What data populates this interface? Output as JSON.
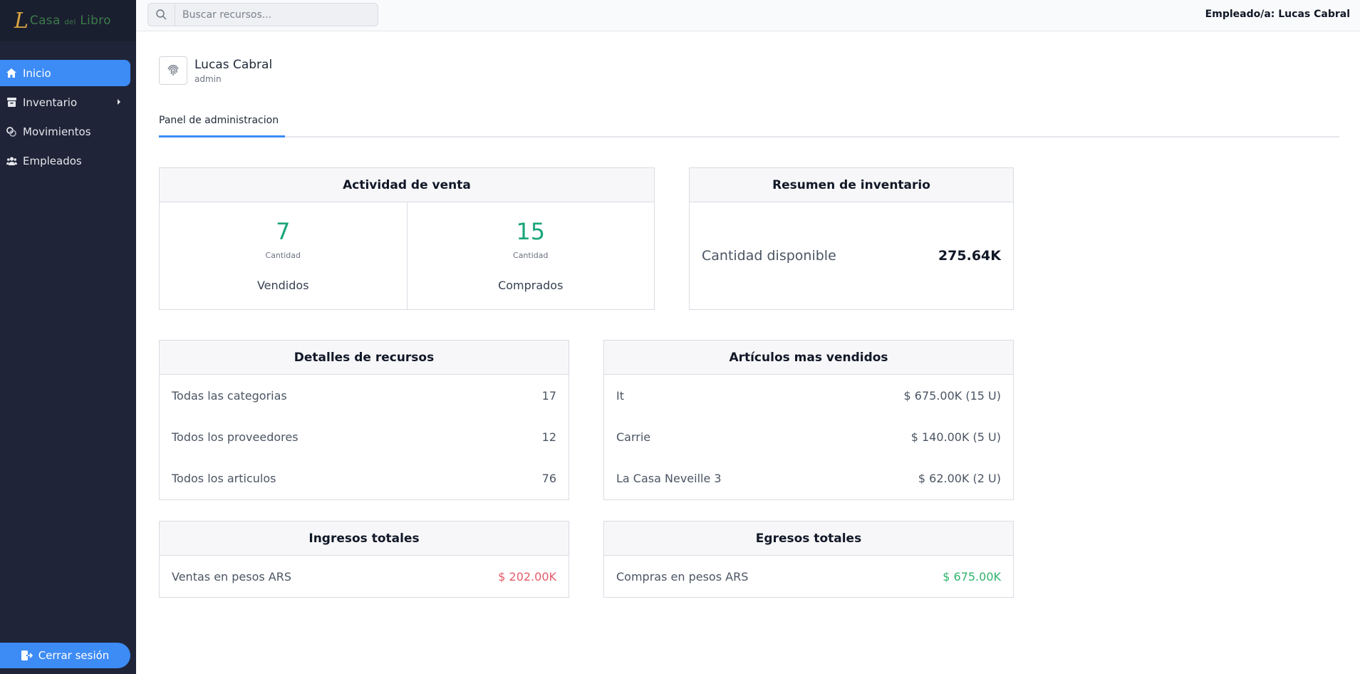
{
  "logo": {
    "mark": "L",
    "text_main": "Casa",
    "text_small": "del",
    "text_end": "Libro"
  },
  "sidebar": {
    "items": [
      {
        "label": "Inicio",
        "icon": "home-icon",
        "active": true
      },
      {
        "label": "Inventario",
        "icon": "archive-icon",
        "has_submenu": true
      },
      {
        "label": "Movimientos",
        "icon": "exchange-icon"
      },
      {
        "label": "Empleados",
        "icon": "users-icon"
      }
    ],
    "logout_label": "Cerrar sesión"
  },
  "topbar": {
    "search_placeholder": "Buscar recursos...",
    "user_label": "Empleado/a: Lucas Cabral"
  },
  "profile": {
    "name": "Lucas Cabral",
    "role": "admin"
  },
  "tabs": [
    {
      "label": "Panel de administracion",
      "active": true
    }
  ],
  "sales_activity": {
    "title": "Actividad de venta",
    "sold": {
      "value": "7",
      "sub": "Cantidad",
      "label": "Vendidos"
    },
    "bought": {
      "value": "15",
      "sub": "Cantidad",
      "label": "Comprados"
    }
  },
  "inventory_summary": {
    "title": "Resumen de inventario",
    "label": "Cantidad disponible",
    "value": "275.64K"
  },
  "resource_details": {
    "title": "Detalles de recursos",
    "rows": [
      {
        "label": "Todas las categorias",
        "value": "17"
      },
      {
        "label": "Todos los proveedores",
        "value": "12"
      },
      {
        "label": "Todos los articulos",
        "value": "76"
      }
    ]
  },
  "top_sellers": {
    "title": "Artículos mas vendidos",
    "rows": [
      {
        "label": "It",
        "value": "$ 675.00K (15 U)"
      },
      {
        "label": "Carrie",
        "value": "$ 140.00K (5 U)"
      },
      {
        "label": "La Casa Neveille 3",
        "value": "$ 62.00K (2 U)"
      }
    ]
  },
  "total_income": {
    "title": "Ingresos totales",
    "label": "Ventas en pesos ARS",
    "value": "$ 202.00K",
    "color": "#e35d6a"
  },
  "total_expenses": {
    "title": "Egresos totales",
    "label": "Compras en pesos ARS",
    "value": "$ 675.00K",
    "color": "#2fb46c"
  },
  "colors": {
    "sidebar_bg": "#1f2438",
    "accent": "#3d8bf5",
    "stat_green": "#1aa57a"
  }
}
